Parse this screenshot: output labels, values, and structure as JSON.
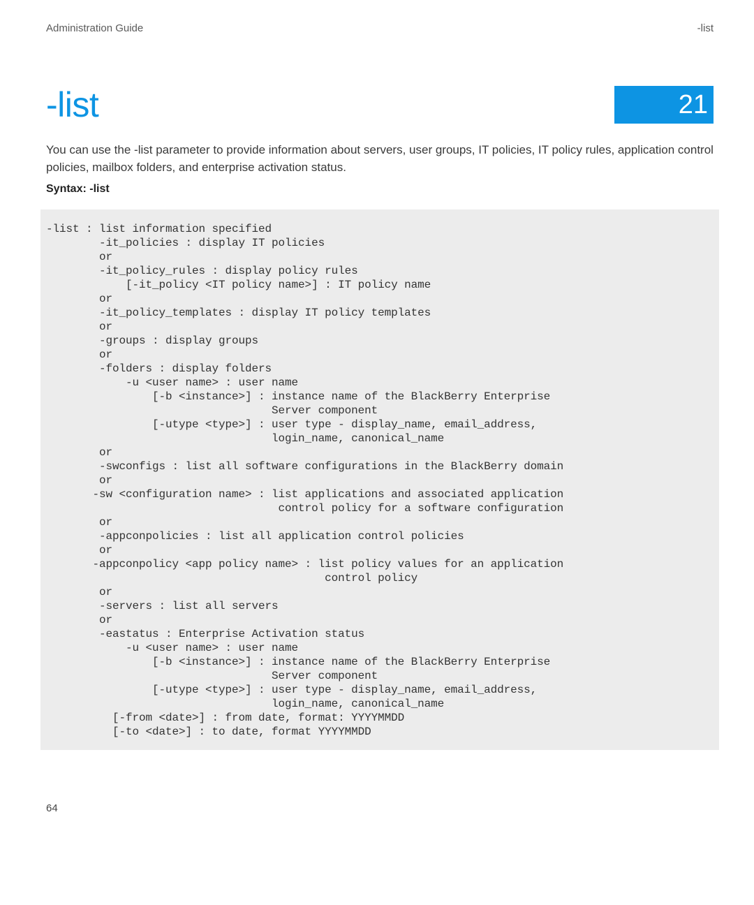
{
  "header": {
    "left": "Administration Guide",
    "right": "-list"
  },
  "title": "-list",
  "chapter_number": "21",
  "intro_text": "You can use the -list parameter to provide information about servers, user groups, IT policies, IT policy rules, application control policies, mailbox folders, and enterprise activation status.",
  "syntax_label_prefix": "Syntax:",
  "syntax_label_value": " -list",
  "code_text": "-list : list information specified\n        -it_policies : display IT policies\n        or\n        -it_policy_rules : display policy rules\n            [-it_policy <IT policy name>] : IT policy name\n        or\n        -it_policy_templates : display IT policy templates\n        or\n        -groups : display groups\n        or\n        -folders : display folders\n            -u <user name> : user name\n                [-b <instance>] : instance name of the BlackBerry Enterprise \n                                  Server component\n                [-utype <type>] : user type - display_name, email_address, \n                                  login_name, canonical_name\n        or\n        -swconfigs : list all software configurations in the BlackBerry domain\n        or\n       -sw <configuration name> : list applications and associated application\n                                   control policy for a software configuration\n        or\n        -appconpolicies : list all application control policies\n        or\n       -appconpolicy <app policy name> : list policy values for an application\n                                          control policy\n        or\n        -servers : list all servers\n        or\n        -eastatus : Enterprise Activation status\n            -u <user name> : user name\n                [-b <instance>] : instance name of the BlackBerry Enterprise \n                                  Server component\n                [-utype <type>] : user type - display_name, email_address, \n                                  login_name, canonical_name\n          [-from <date>] : from date, format: YYYYMMDD\n          [-to <date>] : to date, format YYYYMMDD",
  "page_number": "64"
}
